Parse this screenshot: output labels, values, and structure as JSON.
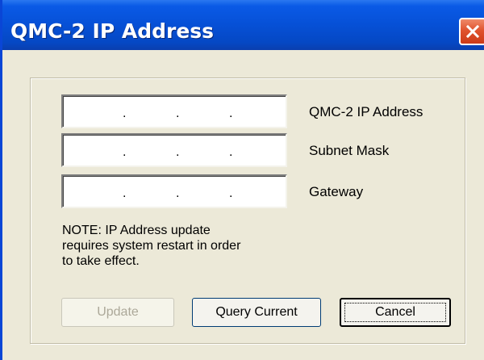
{
  "window": {
    "title": "QMC-2 IP Address"
  },
  "fields": [
    {
      "label": "QMC-2 IP Address",
      "value": ""
    },
    {
      "label": "Subnet Mask",
      "value": ""
    },
    {
      "label": "Gateway",
      "value": ""
    }
  ],
  "ip_separator": ".",
  "note": {
    "lines": [
      "NOTE: IP Address update",
      "requires system restart in order",
      "to take effect."
    ]
  },
  "buttons": {
    "update": "Update",
    "query": "Query Current",
    "cancel": "Cancel"
  },
  "colors": {
    "titlebar": "#0650d6",
    "close": "#e0532e",
    "dialog_bg": "#ece9d8"
  }
}
